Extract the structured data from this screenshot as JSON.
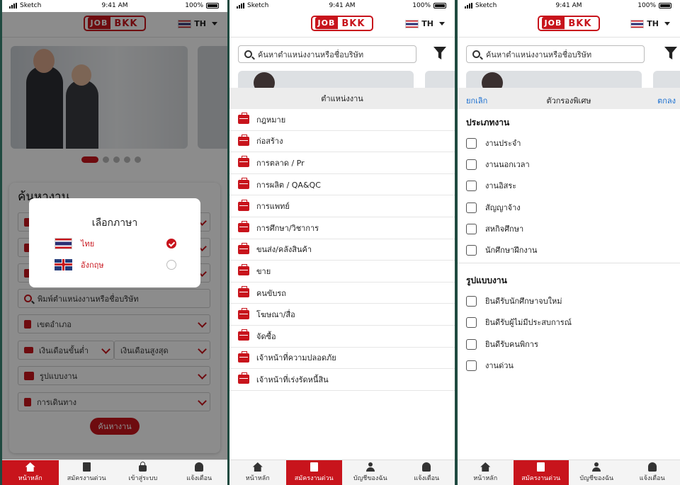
{
  "status": {
    "carrier": "Sketch",
    "time": "9:41 AM",
    "battery": "100%"
  },
  "brand": {
    "logo_left": "JOB",
    "logo_right": "BKK",
    "accent": "#c8141c"
  },
  "lang_selector": {
    "code": "TH"
  },
  "screen1": {
    "search_title": "ค้นหางาน",
    "keyword_placeholder": "พิมพ์ตำแหน่งงานหรือชื่อบริษัท",
    "district": "เขตอำเภอ",
    "salary_min": "เงินเดือนขั้นต่ำ",
    "salary_max": "เงินเดือนสูงสุด",
    "job_type": "รูปแบบงาน",
    "transport": "การเดินทาง",
    "search_button": "ค้นหางาน",
    "dialog": {
      "title": "เลือกภาษา",
      "options": [
        {
          "label": "ไทย",
          "selected": true
        },
        {
          "label": "อังกฤษ",
          "selected": false
        }
      ]
    }
  },
  "screen2": {
    "search_placeholder": "ค้นหาตำแหน่งงานหรือชื่อบริษัท",
    "sheet_title": "ตำแหน่งงาน",
    "positions": [
      "กฎหมาย",
      "ก่อสร้าง",
      "การตลาด / Pr",
      "การผลิต / QA&QC",
      "การแพทย์",
      "การศึกษา/วิชาการ",
      "ขนส่ง/คลังสินค้า",
      "ขาย",
      "คนขับรถ",
      "โฆษณา/สื่อ",
      "จัดซื้อ",
      "เจ้าหน้าที่ความปลอดภัย",
      "เจ้าหน้าที่เร่งรัดหนี้สิน"
    ]
  },
  "screen3": {
    "search_placeholder": "ค้นหาตำแหน่งงานหรือชื่อบริษัท",
    "cancel": "ยกเลิก",
    "title": "ตัวกรองพิเศษ",
    "confirm": "ตกลง",
    "section1": "ประเภทงาน",
    "types": [
      "งานประจำ",
      "งานนอกเวลา",
      "งานอิสระ",
      "สัญญาจ้าง",
      "สหกิจศึกษา",
      "นักศึกษาฝึกงาน"
    ],
    "section2": "รูปแบบงาน",
    "formats": [
      "ยินดีรับนักศึกษาจบใหม่",
      "ยินดีรับผู้ไม่มีประสบการณ์",
      "ยินดีรับคนพิการ",
      "งานด่วน"
    ]
  },
  "tabs1": [
    "หน้าหลัก",
    "สมัครงานด่วน",
    "เข้าสู่ระบบ",
    "แจ้งเตือน"
  ],
  "tabs2": [
    "หน้าหลัก",
    "สมัครงานด่วน",
    "บัญชีของฉัน",
    "แจ้งเตือน"
  ]
}
